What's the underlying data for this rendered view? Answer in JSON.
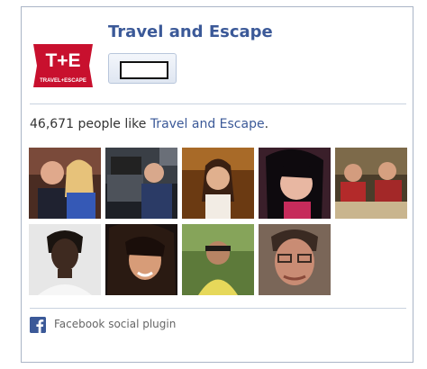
{
  "page": {
    "name": "Travel and Escape",
    "logo_text": "T+E",
    "logo_subtext": "TRAVEL+ESCAPE"
  },
  "like_summary": {
    "count": "46,671",
    "middle_text": " people like ",
    "page_link": "Travel and Escape",
    "end_text": "."
  },
  "faces": [
    {
      "name": "fan-photo-1"
    },
    {
      "name": "fan-photo-2"
    },
    {
      "name": "fan-photo-3"
    },
    {
      "name": "fan-photo-4"
    },
    {
      "name": "fan-photo-5"
    },
    {
      "name": "fan-photo-6"
    },
    {
      "name": "fan-photo-7"
    },
    {
      "name": "fan-photo-8"
    },
    {
      "name": "fan-photo-9"
    }
  ],
  "footer": {
    "label": "Facebook social plugin",
    "icon": "facebook-icon"
  },
  "colors": {
    "brand_blue": "#3b5998",
    "logo_red": "#c8102e"
  }
}
